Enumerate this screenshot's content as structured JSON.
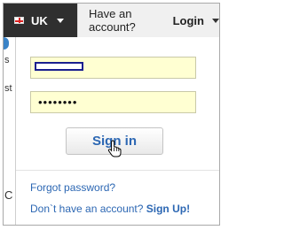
{
  "topbar": {
    "region": {
      "label": "UK",
      "icon": "uk-flag-icon"
    },
    "account": {
      "lead": "Have an account?",
      "login": "Login"
    }
  },
  "background_fragments": [
    "s",
    "st",
    "C"
  ],
  "form": {
    "username": {
      "value": "",
      "placeholder": ""
    },
    "password": {
      "value": "••••••••",
      "placeholder": ""
    },
    "signin_label": "Sign in"
  },
  "links": {
    "forgot": "Forgot password?",
    "no_account": "Don`t have an account?",
    "signup": "Sign Up!"
  },
  "colors": {
    "topbar": "#2f2f2f",
    "input_bg": "#ffffd2",
    "link": "#2c67b3"
  }
}
